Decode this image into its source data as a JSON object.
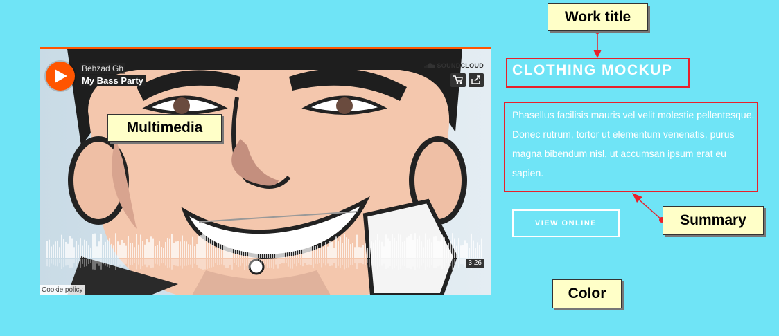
{
  "player": {
    "artist": "Behzad Gh",
    "track": "My Bass Party",
    "brand": "SOUNDCLOUD",
    "duration": "3:26",
    "cookie_policy": "Cookie policy",
    "accent_color": "#ff5500",
    "icons": [
      "play-icon",
      "soundcloud-logo-icon",
      "cart-icon",
      "share-icon"
    ]
  },
  "portfolio": {
    "work_title": "CLOTHING MOCKUP",
    "summary": "Phasellus facilisis mauris vel velit molestie pellentesque. Donec rutrum, tortor ut elementum venenatis, purus magna bibendum nisl, ut accumsan ipsum erat eu sapien.",
    "button_label": "VIEW ONLINE",
    "background_color": "#6fe4f6"
  },
  "annotations": {
    "work_title": "Work title",
    "multimedia": "Multimedia",
    "summary": "Summary",
    "color": "Color"
  }
}
